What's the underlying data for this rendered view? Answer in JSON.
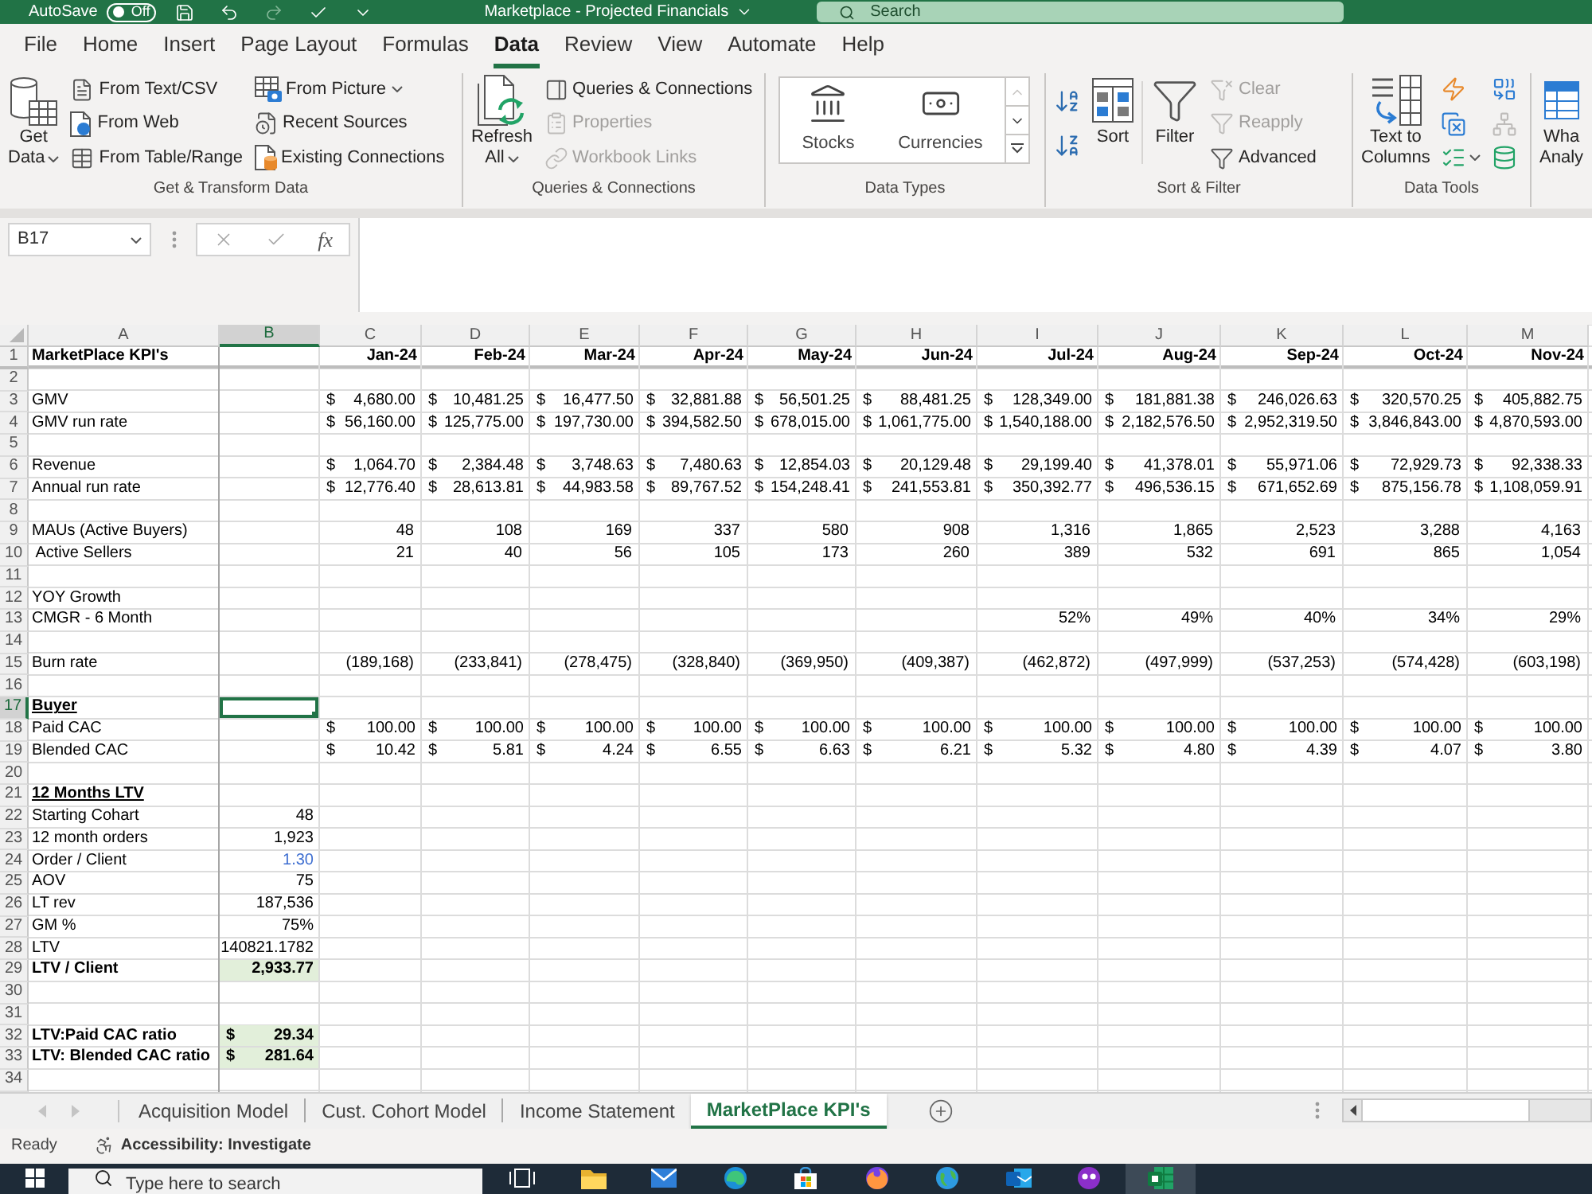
{
  "title_bar": {
    "autosave": {
      "label": "AutoSave",
      "state": "Off",
      "on": false
    },
    "quick_access": [
      {
        "disabled": false
      },
      {
        "disabled": false
      },
      {
        "disabled": true
      },
      {
        "disabled": false
      },
      {
        "disabled": false
      }
    ],
    "title": "Marketplace - Projected Financials",
    "search": {
      "placeholder": "Search"
    }
  },
  "ribbon_tabs": [
    {
      "label": "File",
      "selected": false
    },
    {
      "label": "Home",
      "selected": false
    },
    {
      "label": "Insert",
      "selected": false
    },
    {
      "label": "Page Layout",
      "selected": false
    },
    {
      "label": "Formulas",
      "selected": false
    },
    {
      "label": "Data",
      "selected": true
    },
    {
      "label": "Review",
      "selected": false
    },
    {
      "label": "View",
      "selected": false
    },
    {
      "label": "Automate",
      "selected": false
    },
    {
      "label": "Help",
      "selected": false
    }
  ],
  "ribbon_groups": [
    {
      "label": "Get & Transform Data",
      "items": [
        {
          "kind": "large",
          "lines": [
            "Get",
            "Data"
          ],
          "dropdown": true,
          "disabled": false
        },
        {
          "kind": "small",
          "label": "From Text/CSV",
          "dropdown": false,
          "disabled": false
        },
        {
          "kind": "small",
          "label": "From Web",
          "dropdown": false,
          "disabled": false
        },
        {
          "kind": "small",
          "label": "From Table/Range",
          "dropdown": false,
          "disabled": false
        },
        {
          "kind": "small",
          "label": "From Picture",
          "dropdown": true,
          "disabled": false
        },
        {
          "kind": "small",
          "label": "Recent Sources",
          "dropdown": false,
          "disabled": false
        },
        {
          "kind": "small",
          "label": "Existing Connections",
          "dropdown": false,
          "disabled": false
        }
      ]
    },
    {
      "label": "Queries & Connections",
      "items": [
        {
          "kind": "large",
          "lines": [
            "Refresh",
            "All"
          ],
          "dropdown": true,
          "disabled": false
        },
        {
          "kind": "small",
          "label": "Queries & Connections",
          "dropdown": false,
          "disabled": false
        },
        {
          "kind": "small",
          "label": "Properties",
          "dropdown": false,
          "disabled": true
        },
        {
          "kind": "small",
          "label": "Workbook Links",
          "dropdown": false,
          "disabled": true
        }
      ]
    },
    {
      "label": "Data Types",
      "items": [
        {
          "kind": "gallery",
          "scroll_up": false,
          "entries": [
            {
              "label": "Stocks"
            },
            {
              "label": "Currencies"
            }
          ]
        }
      ]
    },
    {
      "label": "Sort & Filter",
      "items": [
        {
          "kind": "icon",
          "dropdown": false,
          "disabled": false
        },
        {
          "kind": "icon",
          "dropdown": false,
          "disabled": false
        },
        {
          "kind": "large",
          "lines": [
            "Sort"
          ],
          "dropdown": false,
          "disabled": false
        },
        {
          "kind": "large",
          "lines": [
            "Filter"
          ],
          "dropdown": false,
          "disabled": false
        },
        {
          "kind": "small",
          "label": "Clear",
          "dropdown": false,
          "disabled": true
        },
        {
          "kind": "small",
          "label": "Reapply",
          "dropdown": false,
          "disabled": true
        },
        {
          "kind": "small",
          "label": "Advanced",
          "dropdown": false,
          "disabled": false
        }
      ]
    },
    {
      "label": "Data Tools",
      "items": [
        {
          "kind": "large",
          "lines": [
            "Text to",
            "Columns"
          ],
          "dropdown": false,
          "disabled": false
        },
        {
          "kind": "icon",
          "dropdown": false,
          "disabled": false
        },
        {
          "kind": "icon",
          "dropdown": false,
          "disabled": false
        },
        {
          "kind": "icon",
          "dropdown": true,
          "disabled": false
        },
        {
          "kind": "icon",
          "dropdown": false,
          "disabled": false
        },
        {
          "kind": "icon",
          "dropdown": false,
          "disabled": true
        },
        {
          "kind": "icon",
          "dropdown": false,
          "disabled": false
        }
      ]
    },
    {
      "items": [
        {
          "kind": "large",
          "lines": [
            "Wha",
            "Analy"
          ],
          "dropdown": false,
          "disabled": false
        }
      ]
    }
  ],
  "formula_bar": {
    "name_box": "B17",
    "function_button": "fx"
  },
  "sheet": {
    "columns": [
      {
        "label": "A",
        "selected": false
      },
      {
        "label": "B",
        "selected": true
      },
      {
        "label": "C",
        "selected": false
      },
      {
        "label": "D",
        "selected": false
      },
      {
        "label": "E",
        "selected": false
      },
      {
        "label": "F",
        "selected": false
      },
      {
        "label": "G",
        "selected": false
      },
      {
        "label": "H",
        "selected": false
      },
      {
        "label": "I",
        "selected": false
      },
      {
        "label": "J",
        "selected": false
      },
      {
        "label": "K",
        "selected": false
      },
      {
        "label": "L",
        "selected": false
      },
      {
        "label": "M",
        "selected": false
      }
    ],
    "rows": [
      {
        "number": "1",
        "selected": false,
        "label": {
          "text": "MarketPlace KPI's",
          "bold": true
        },
        "kind": "header",
        "values": [
          "Jan-24",
          "Feb-24",
          "Mar-24",
          "Apr-24",
          "May-24",
          "Jun-24",
          "Jul-24",
          "Aug-24",
          "Sep-24",
          "Oct-24",
          "Nov-24"
        ]
      },
      {
        "number": "2",
        "selected": false
      },
      {
        "number": "3",
        "selected": false,
        "label": {
          "text": "GMV"
        },
        "kind": "accounting",
        "values": [
          {
            "currency": "$",
            "amount": "4,680.00"
          },
          {
            "currency": "$",
            "amount": "10,481.25"
          },
          {
            "currency": "$",
            "amount": "16,477.50"
          },
          {
            "currency": "$",
            "amount": "32,881.88"
          },
          {
            "currency": "$",
            "amount": "56,501.25"
          },
          {
            "currency": "$",
            "amount": "88,481.25"
          },
          {
            "currency": "$",
            "amount": "128,349.00"
          },
          {
            "currency": "$",
            "amount": "181,881.38"
          },
          {
            "currency": "$",
            "amount": "246,026.63"
          },
          {
            "currency": "$",
            "amount": "320,570.25"
          },
          {
            "currency": "$",
            "amount": "405,882.75"
          }
        ]
      },
      {
        "number": "4",
        "selected": false,
        "label": {
          "text": "GMV run rate"
        },
        "kind": "accounting",
        "values": [
          {
            "currency": "$",
            "amount": "56,160.00"
          },
          {
            "currency": "$",
            "amount": "125,775.00"
          },
          {
            "currency": "$",
            "amount": "197,730.00"
          },
          {
            "currency": "$",
            "amount": "394,582.50"
          },
          {
            "currency": "$",
            "amount": "678,015.00"
          },
          {
            "currency": "$",
            "amount": "1,061,775.00"
          },
          {
            "currency": "$",
            "amount": "1,540,188.00"
          },
          {
            "currency": "$",
            "amount": "2,182,576.50"
          },
          {
            "currency": "$",
            "amount": "2,952,319.50"
          },
          {
            "currency": "$",
            "amount": "3,846,843.00"
          },
          {
            "currency": "$",
            "amount": "4,870,593.00"
          }
        ]
      },
      {
        "number": "5",
        "selected": false
      },
      {
        "number": "6",
        "selected": false,
        "label": {
          "text": "Revenue"
        },
        "kind": "accounting",
        "values": [
          {
            "currency": "$",
            "amount": "1,064.70"
          },
          {
            "currency": "$",
            "amount": "2,384.48"
          },
          {
            "currency": "$",
            "amount": "3,748.63"
          },
          {
            "currency": "$",
            "amount": "7,480.63"
          },
          {
            "currency": "$",
            "amount": "12,854.03"
          },
          {
            "currency": "$",
            "amount": "20,129.48"
          },
          {
            "currency": "$",
            "amount": "29,199.40"
          },
          {
            "currency": "$",
            "amount": "41,378.01"
          },
          {
            "currency": "$",
            "amount": "55,971.06"
          },
          {
            "currency": "$",
            "amount": "72,929.73"
          },
          {
            "currency": "$",
            "amount": "92,338.33"
          }
        ]
      },
      {
        "number": "7",
        "selected": false,
        "label": {
          "text": "Annual run rate"
        },
        "kind": "accounting",
        "values": [
          {
            "currency": "$",
            "amount": "12,776.40"
          },
          {
            "currency": "$",
            "amount": "28,613.81"
          },
          {
            "currency": "$",
            "amount": "44,983.58"
          },
          {
            "currency": "$",
            "amount": "89,767.52"
          },
          {
            "currency": "$",
            "amount": "154,248.41"
          },
          {
            "currency": "$",
            "amount": "241,553.81"
          },
          {
            "currency": "$",
            "amount": "350,392.77"
          },
          {
            "currency": "$",
            "amount": "496,536.15"
          },
          {
            "currency": "$",
            "amount": "671,652.69"
          },
          {
            "currency": "$",
            "amount": "875,156.78"
          },
          {
            "currency": "$",
            "amount": "1,108,059.91"
          }
        ]
      },
      {
        "number": "8",
        "selected": false
      },
      {
        "number": "9",
        "selected": false,
        "label": {
          "text": "MAUs (Active Buyers)"
        },
        "kind": "number",
        "values": [
          "48",
          "108",
          "169",
          "337",
          "580",
          "908",
          "1,316",
          "1,865",
          "2,523",
          "3,288",
          "4,163"
        ]
      },
      {
        "number": "10",
        "selected": false,
        "label": {
          "text": " Active Sellers"
        },
        "kind": "number",
        "values": [
          "21",
          "40",
          "56",
          "105",
          "173",
          "260",
          "389",
          "532",
          "691",
          "865",
          "1,054"
        ]
      },
      {
        "number": "11",
        "selected": false
      },
      {
        "number": "12",
        "selected": false,
        "label": {
          "text": "YOY Growth"
        }
      },
      {
        "number": "13",
        "selected": false,
        "label": {
          "text": "CMGR - 6 Month"
        },
        "kind": "number",
        "values": {
          "I": "52%",
          "J": "49%",
          "K": "40%",
          "L": "34%",
          "M": "29%"
        }
      },
      {
        "number": "14",
        "selected": false
      },
      {
        "number": "15",
        "selected": false,
        "label": {
          "text": "Burn rate"
        },
        "kind": "number",
        "values": [
          "(189,168)",
          "(233,841)",
          "(278,475)",
          "(328,840)",
          "(369,950)",
          "(409,387)",
          "(462,872)",
          "(497,999)",
          "(537,253)",
          "(574,428)",
          "(603,198)"
        ]
      },
      {
        "number": "16",
        "selected": false
      },
      {
        "number": "17",
        "selected": true,
        "label": {
          "text": "Buyer",
          "bold": true,
          "underline": true
        }
      },
      {
        "number": "18",
        "selected": false,
        "label": {
          "text": "Paid CAC"
        },
        "kind": "accounting",
        "values": [
          {
            "currency": "$",
            "amount": "100.00"
          },
          {
            "currency": "$",
            "amount": "100.00"
          },
          {
            "currency": "$",
            "amount": "100.00"
          },
          {
            "currency": "$",
            "amount": "100.00"
          },
          {
            "currency": "$",
            "amount": "100.00"
          },
          {
            "currency": "$",
            "amount": "100.00"
          },
          {
            "currency": "$",
            "amount": "100.00"
          },
          {
            "currency": "$",
            "amount": "100.00"
          },
          {
            "currency": "$",
            "amount": "100.00"
          },
          {
            "currency": "$",
            "amount": "100.00"
          },
          {
            "currency": "$",
            "amount": "100.00"
          }
        ]
      },
      {
        "number": "19",
        "selected": false,
        "label": {
          "text": "Blended CAC"
        },
        "kind": "accounting",
        "values": [
          {
            "currency": "$",
            "amount": "10.42"
          },
          {
            "currency": "$",
            "amount": "5.81"
          },
          {
            "currency": "$",
            "amount": "4.24"
          },
          {
            "currency": "$",
            "amount": "6.55"
          },
          {
            "currency": "$",
            "amount": "6.63"
          },
          {
            "currency": "$",
            "amount": "6.21"
          },
          {
            "currency": "$",
            "amount": "5.32"
          },
          {
            "currency": "$",
            "amount": "4.80"
          },
          {
            "currency": "$",
            "amount": "4.39"
          },
          {
            "currency": "$",
            "amount": "4.07"
          },
          {
            "currency": "$",
            "amount": "3.80"
          }
        ]
      },
      {
        "number": "20",
        "selected": false
      },
      {
        "number": "21",
        "selected": false,
        "label": {
          "text": "12 Months LTV",
          "bold": true,
          "underline": true
        }
      },
      {
        "number": "22",
        "selected": false,
        "label": {
          "text": "Starting Cohart"
        },
        "b": {
          "kind": "text",
          "text": "48"
        }
      },
      {
        "number": "23",
        "selected": false,
        "label": {
          "text": "12 month orders"
        },
        "b": {
          "kind": "text",
          "text": "1,923"
        }
      },
      {
        "number": "24",
        "selected": false,
        "label": {
          "text": "Order / Client"
        },
        "b": {
          "kind": "text",
          "text": "1.30",
          "color": "#3f6fd1"
        }
      },
      {
        "number": "25",
        "selected": false,
        "label": {
          "text": "AOV"
        },
        "b": {
          "kind": "text",
          "text": "75"
        }
      },
      {
        "number": "26",
        "selected": false,
        "label": {
          "text": "LT rev"
        },
        "b": {
          "kind": "text",
          "text": "187,536"
        }
      },
      {
        "number": "27",
        "selected": false,
        "label": {
          "text": "GM %"
        },
        "b": {
          "kind": "text",
          "text": "75%"
        }
      },
      {
        "number": "28",
        "selected": false,
        "label": {
          "text": "LTV"
        },
        "b": {
          "kind": "text",
          "text": "140821.1782"
        }
      },
      {
        "number": "29",
        "selected": false,
        "label": {
          "text": "LTV / Client",
          "bold": true
        },
        "b": {
          "kind": "text",
          "text": "2,933.77",
          "bold": true,
          "highlight": true
        }
      },
      {
        "number": "30",
        "selected": false
      },
      {
        "number": "31",
        "selected": false
      },
      {
        "number": "32",
        "selected": false,
        "label": {
          "text": "LTV:Paid CAC ratio",
          "bold": true
        },
        "b": {
          "kind": "accounting",
          "currency": "$",
          "amount": "29.34",
          "bold": true,
          "highlight": true
        }
      },
      {
        "number": "33",
        "selected": false,
        "label": {
          "text": "LTV: Blended CAC ratio",
          "bold": true
        },
        "b": {
          "kind": "accounting",
          "currency": "$",
          "amount": "281.64",
          "bold": true,
          "highlight": true
        }
      },
      {
        "number": "34",
        "selected": false
      }
    ]
  },
  "sheet_navigation": {
    "disabled": true
  },
  "sheet_tabs": [
    {
      "label": "Acquisition Model",
      "selected": false
    },
    {
      "label": "Cust. Cohort Model",
      "selected": false
    },
    {
      "label": "Income Statement",
      "selected": false
    },
    {
      "label": "MarketPlace KPI's",
      "selected": true
    }
  ],
  "status_bar": {
    "mode": "Ready",
    "accessibility": "Accessibility: Investigate"
  },
  "taskbar": {
    "search": {
      "placeholder": "Type here to search"
    },
    "apps": [
      {
        "active": false
      },
      {
        "active": false
      },
      {
        "active": false
      },
      {
        "active": false
      },
      {
        "active": false
      },
      {
        "active": false
      },
      {
        "active": false
      },
      {
        "active": false
      },
      {
        "active": false
      },
      {
        "active": true
      }
    ]
  }
}
